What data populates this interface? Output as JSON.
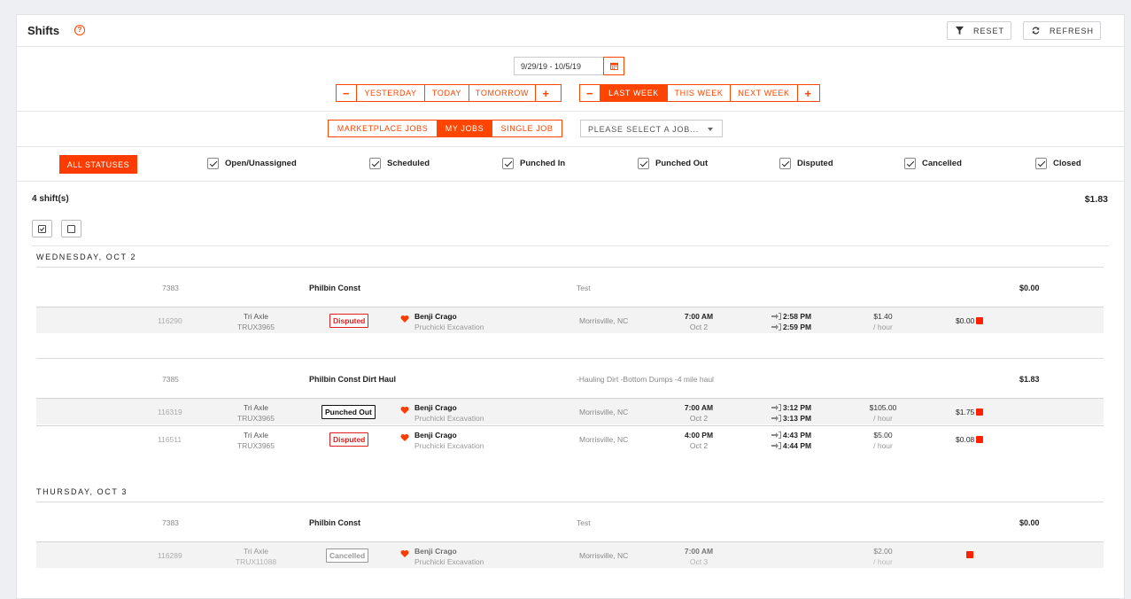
{
  "header": {
    "title": "Shifts",
    "reset_label": "RESET",
    "refresh_label": "REFRESH"
  },
  "date_range": {
    "value": "9/29/19  -  10/5/19"
  },
  "day_nav": {
    "minus": "−",
    "yesterday": "YESTERDAY",
    "today": "TODAY",
    "tomorrow": "TOMORROW",
    "plus": "+"
  },
  "week_nav": {
    "minus": "−",
    "last_week": "LAST WEEK",
    "this_week": "THIS WEEK",
    "next_week": "NEXT WEEK",
    "plus": "+"
  },
  "job_filter": {
    "marketplace": "MARKETPLACE JOBS",
    "my_jobs": "MY JOBS",
    "single_job": "SINGLE JOB",
    "select_placeholder": "PLEASE SELECT A JOB..."
  },
  "statuses": {
    "all_label": "ALL STATUSES",
    "items": [
      "Open/Unassigned",
      "Scheduled",
      "Punched In",
      "Punched Out",
      "Disputed",
      "Cancelled",
      "Closed"
    ]
  },
  "summary": {
    "count": "4 shift(s)",
    "total": "$1.83"
  },
  "days": [
    {
      "label": "WEDNESDAY, OCT 2",
      "jobs": [
        {
          "id": "7383",
          "name": "Philbin Const",
          "desc": "Test",
          "amount": "$0.00",
          "shifts": [
            {
              "id": "116290",
              "truck_type": "Tri Axle",
              "truck_id": "TRUX3965",
              "status": "Disputed",
              "driver": "Benji Crago",
              "company": "Pruchicki Excavation",
              "location": "Morrisville, NC",
              "start_time": "7:00 AM",
              "start_date": "Oct 2",
              "punch_in": "2:58 PM",
              "punch_out": "2:59 PM",
              "rate": "$1.40",
              "rate_unit": "/ hour",
              "pay": "$0.00"
            }
          ]
        },
        {
          "id": "7385",
          "name": "Philbin Const Dirt Haul",
          "desc": "-Hauling Dirt -Bottom Dumps -4 mile haul",
          "amount": "$1.83",
          "shifts": [
            {
              "id": "116319",
              "truck_type": "Tri Axle",
              "truck_id": "TRUX3965",
              "status": "Punched Out",
              "driver": "Benji Crago",
              "company": "Pruchicki Excavation",
              "location": "Morrisville, NC",
              "start_time": "7:00 AM",
              "start_date": "Oct 2",
              "punch_in": "3:12 PM",
              "punch_out": "3:13 PM",
              "rate": "$105.00",
              "rate_unit": "/ hour",
              "pay": "$1.75"
            },
            {
              "id": "116511",
              "truck_type": "Tri Axle",
              "truck_id": "TRUX3965",
              "status": "Disputed",
              "driver": "Benji Crago",
              "company": "Pruchicki Excavation",
              "location": "Morrisville, NC",
              "start_time": "4:00 PM",
              "start_date": "Oct 2",
              "punch_in": "4:43 PM",
              "punch_out": "4:44 PM",
              "rate": "$5.00",
              "rate_unit": "/ hour",
              "pay": "$0.08"
            }
          ]
        }
      ]
    },
    {
      "label": "THURSDAY, OCT 3",
      "jobs": [
        {
          "id": "7383",
          "name": "Philbin Const",
          "desc": "Test",
          "amount": "$0.00",
          "shifts": [
            {
              "id": "116289",
              "truck_type": "Tri Axle",
              "truck_id": "TRUX11088",
              "status": "Cancelled",
              "driver": "Benji Crago",
              "company": "Pruchicki Excavation",
              "location": "Morrisville, NC",
              "start_time": "7:00 AM",
              "start_date": "Oct 3",
              "rate": "$2.00",
              "rate_unit": "/ hour"
            }
          ]
        }
      ]
    }
  ],
  "colors": {
    "accent": "#ff4500",
    "disputed": "#e02020"
  }
}
